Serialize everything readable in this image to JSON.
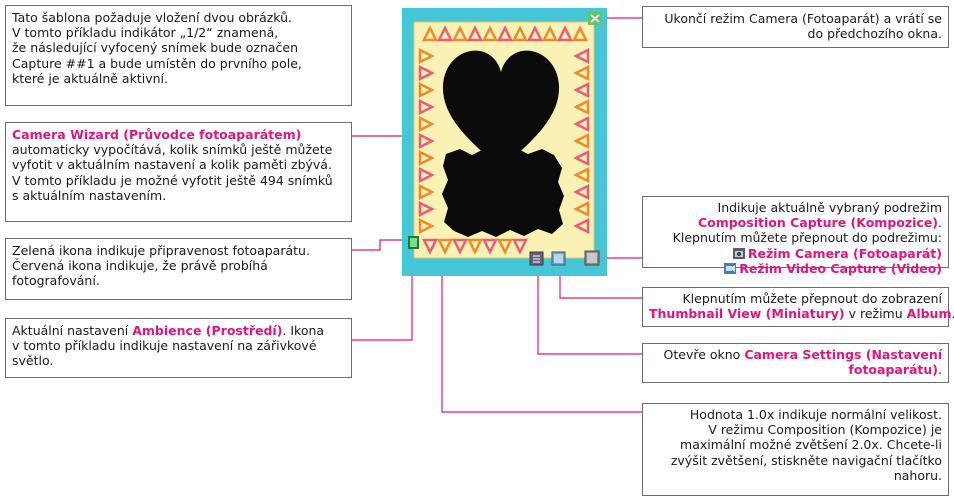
{
  "boxes": {
    "template": {
      "lines": [
        "Tato šablona požaduje vložení dvou obrázků.",
        "V tomto příkladu indikátor „1/2“ znamená,",
        "že následující vyfocený snímek bude označen",
        "Capture ##1 a bude umístěn do prvního pole,",
        "které je aktuálně aktivní."
      ]
    },
    "wizard": {
      "highlight": "Camera Wizard (Průvodce fotoaparátem)",
      "lines": [
        "automaticky vypočítává, kolik snímků ještě můžete",
        "vyfotit v aktuálním nastavení a kolik paměti zbývá.",
        "V tomto příkladu je možné vyfotit ještě 494 snímků",
        "s aktuálním nastavením."
      ]
    },
    "ready": {
      "lines": [
        "Zelená ikona indikuje připravenost fotoaparátu.",
        "Červená ikona indikuje, že právě probíhá",
        "fotografování."
      ]
    },
    "ambience": {
      "line1_pre": "Aktuální nastavení ",
      "line1_hl": "Ambience (Prostředí)",
      "line1_post": ". Ikona",
      "lines": [
        "v tomto příkladu indikuje nastavení na zářivkové",
        "světlo."
      ]
    },
    "exit": {
      "lines": [
        "Ukončí režim Camera (Fotoaparát) a vrátí se",
        "do předchozího okna."
      ]
    },
    "submode": {
      "line1": "Indikuje aktuálně vybraný podrežim",
      "line2_hl": "Composition Capture (Kompozice)",
      "line2_post": ".",
      "line3": "Klepnutím můžete přepnout do podrežimu:",
      "opt1": "Režim Camera (Fotoaparát)",
      "opt2": "Režim Video Capture (Video)"
    },
    "thumb": {
      "line1": "Klepnutím můžete přepnout do zobrazení",
      "hl1": "Thumbnail View (Miniatury)",
      "mid": " v režimu ",
      "hl2": "Album",
      "end": "."
    },
    "settings": {
      "pre": "Otevře okno ",
      "hl1": "Camera Settings (Nastavení",
      "hl2": "fotoaparátu)",
      "end": "."
    },
    "zoom": {
      "lines": [
        "Hodnota 1.0x indikuje normální velikost.",
        "V režimu Composition (Kompozice) je",
        "maximální možné zvětšení 2.0x. Chcete-li",
        "zvýšit zvětšení, stiskněte navigační tlačítko",
        "nahoru."
      ]
    }
  },
  "colors": {
    "highlight": "#e0157f",
    "screen_bg": "#46c7d8",
    "frame_bg": "#faf1b5",
    "triangle_orange": "#ee8a2c",
    "triangle_pink": "#ee5a7a"
  },
  "icons": [
    "exit-icon",
    "ready-icon",
    "settings-icon",
    "album-icon",
    "submode-icon",
    "camera-mode-icon",
    "video-mode-icon"
  ]
}
